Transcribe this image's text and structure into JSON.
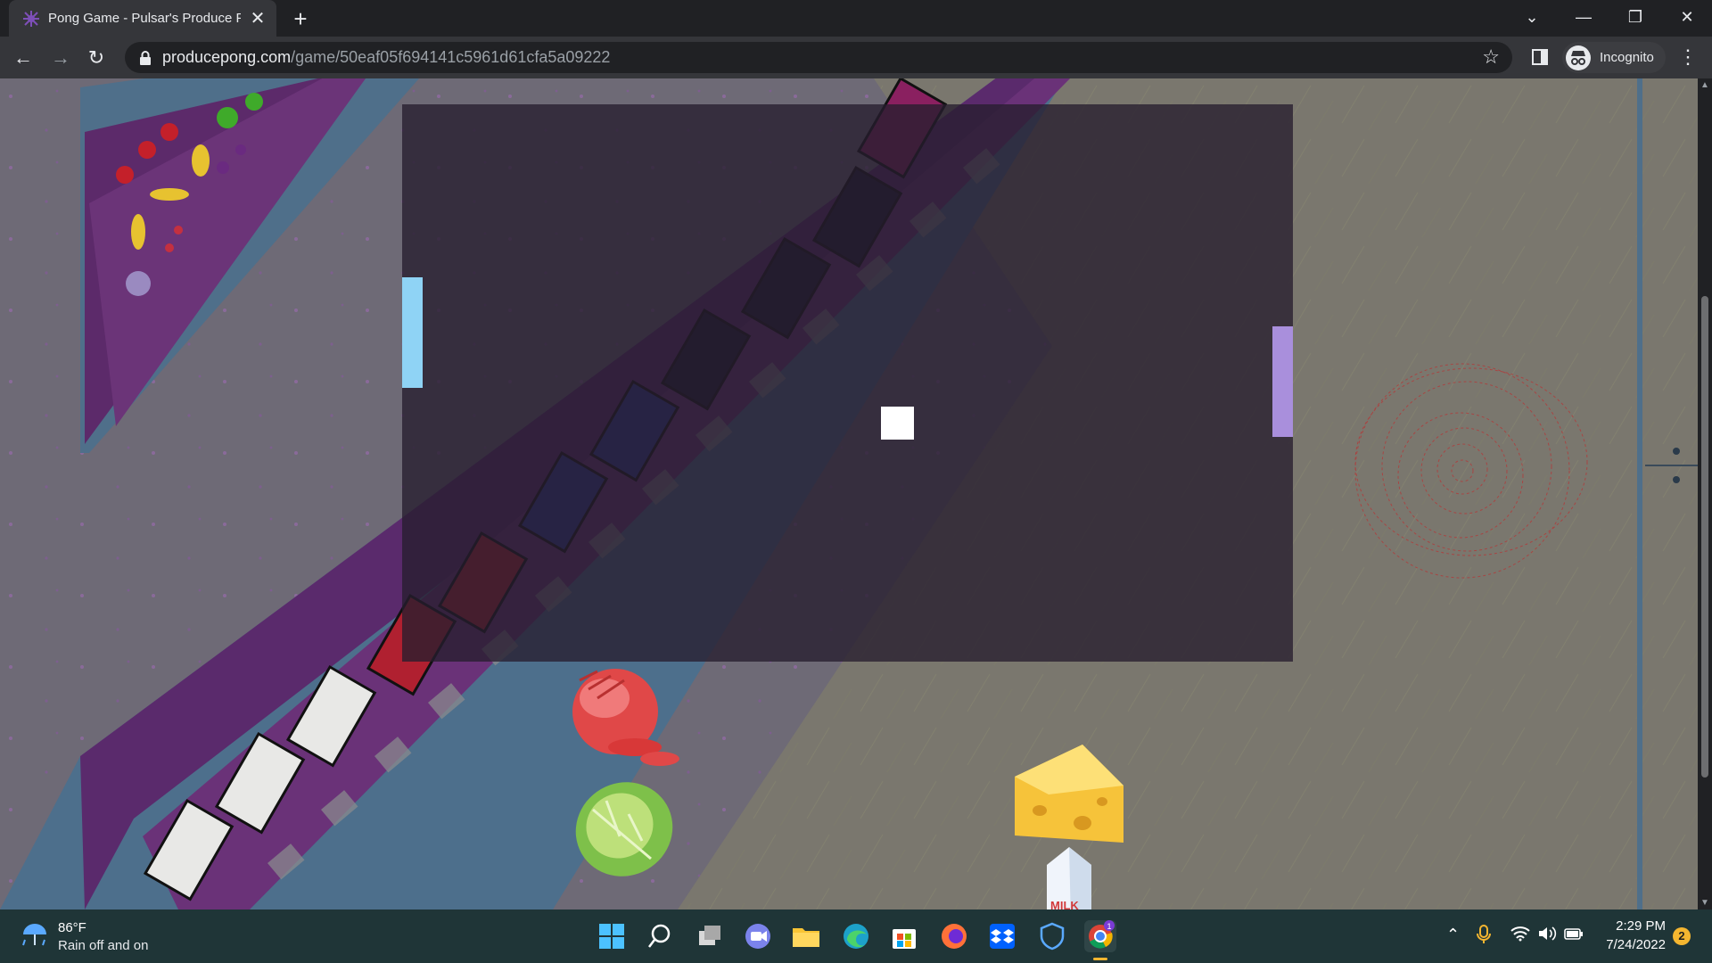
{
  "browser": {
    "tab_title": "Pong Game - Pulsar's Produce Po",
    "tab_close": "✕",
    "new_tab": "+",
    "url_domain": "producepong.com",
    "url_path": "/game/50eaf05f694141c5961d61cfa5a09222",
    "profile_label": "Incognito",
    "window_controls": {
      "tabsearch": "⌄",
      "minimize": "—",
      "restore": "❐",
      "close": "✕"
    },
    "nav": {
      "back": "←",
      "forward": "→",
      "reload": "↻"
    },
    "bookmark_star": "☆",
    "menu": "⋮"
  },
  "game": {
    "left_paddle_color": "#8fd3f5",
    "right_paddle_color": "#a98fdc",
    "ball_color": "#ffffff",
    "overlay_color": "#261e2e"
  },
  "food_items": [
    {
      "name": "ham",
      "label": ""
    },
    {
      "name": "lettuce",
      "label": ""
    },
    {
      "name": "cheese",
      "label": ""
    },
    {
      "name": "milk",
      "label": "MILK"
    }
  ],
  "taskbar": {
    "weather_temp": "86°F",
    "weather_desc": "Rain off and on",
    "time": "2:29 PM",
    "date": "7/24/2022",
    "notification_count": "2",
    "chrome_badge": "1"
  }
}
